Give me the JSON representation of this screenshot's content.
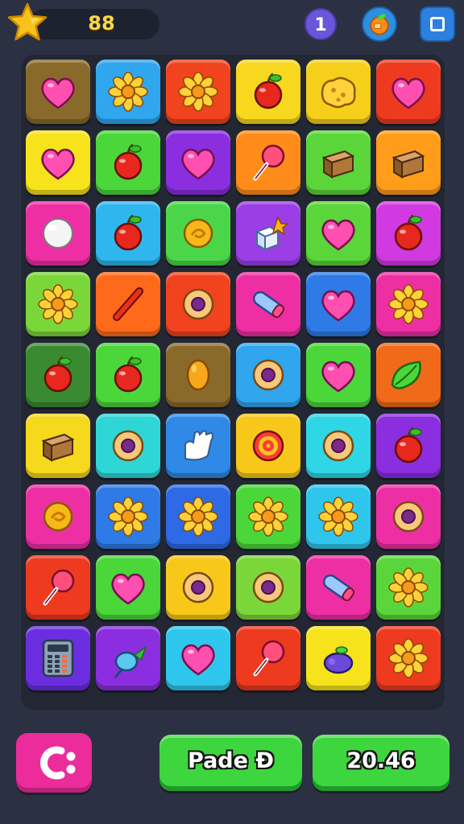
{
  "header": {
    "score": "88",
    "level": "1",
    "star_icon": "star-icon",
    "booster_icon": "fruit-booster-icon",
    "menu_icon": "square-menu-icon"
  },
  "board": {
    "rows": [
      [
        {
          "color": "#8a6a2a",
          "icon": "heart"
        },
        {
          "color": "#2fa6ee",
          "icon": "flower"
        },
        {
          "color": "#f0431e",
          "icon": "flower"
        },
        {
          "color": "#f7d81e",
          "icon": "apple"
        },
        {
          "color": "#f5cf1a",
          "icon": "cookie"
        },
        {
          "color": "#ee3a1f",
          "icon": "heart"
        }
      ],
      [
        {
          "color": "#f6e31c",
          "icon": "heart"
        },
        {
          "color": "#4bd63a",
          "icon": "apple"
        },
        {
          "color": "#8a2ee0",
          "icon": "heart"
        },
        {
          "color": "#ff8c1a",
          "icon": "lollipop"
        },
        {
          "color": "#5bd63a",
          "icon": "box"
        },
        {
          "color": "#ff9c1a",
          "icon": "box"
        }
      ],
      [
        {
          "color": "#ee2fa4",
          "icon": "ball"
        },
        {
          "color": "#2fb6ee",
          "icon": "apple"
        },
        {
          "color": "#4bd64a",
          "icon": "candy"
        },
        {
          "color": "#9b3ee6",
          "icon": "cube"
        },
        {
          "color": "#5bd63a",
          "icon": "heart"
        },
        {
          "color": "#d03ae0",
          "icon": "apple"
        }
      ],
      [
        {
          "color": "#7bd63a",
          "icon": "flower"
        },
        {
          "color": "#ff6a1a",
          "icon": "stick"
        },
        {
          "color": "#f0431e",
          "icon": "donut"
        },
        {
          "color": "#ee2fa4",
          "icon": "tube"
        },
        {
          "color": "#2e7ae6",
          "icon": "heart"
        },
        {
          "color": "#ee2fa4",
          "icon": "flower"
        }
      ],
      [
        {
          "color": "#3a8a32",
          "icon": "apple"
        },
        {
          "color": "#4bd63a",
          "icon": "apple"
        },
        {
          "color": "#8a6a2a",
          "icon": "lemon"
        },
        {
          "color": "#2fa6ee",
          "icon": "donut"
        },
        {
          "color": "#4bd63a",
          "icon": "heart"
        },
        {
          "color": "#f06a1a",
          "icon": "leaf"
        }
      ],
      [
        {
          "color": "#f6d81c",
          "icon": "box"
        },
        {
          "color": "#2fd6d6",
          "icon": "donut"
        },
        {
          "color": "#2e8ae6",
          "icon": "glove"
        },
        {
          "color": "#f7c81a",
          "icon": "target"
        },
        {
          "color": "#2fd6e6",
          "icon": "donut"
        },
        {
          "color": "#8a2ee0",
          "icon": "apple"
        }
      ],
      [
        {
          "color": "#ee2fa4",
          "icon": "candy"
        },
        {
          "color": "#2e7ae6",
          "icon": "flower"
        },
        {
          "color": "#2e6ae6",
          "icon": "flower"
        },
        {
          "color": "#4bd63a",
          "icon": "flower"
        },
        {
          "color": "#2fc6ee",
          "icon": "flower"
        },
        {
          "color": "#ee2fa4",
          "icon": "donut"
        }
      ],
      [
        {
          "color": "#ee3a1f",
          "icon": "lollipop"
        },
        {
          "color": "#4bd63a",
          "icon": "heart"
        },
        {
          "color": "#f7c81a",
          "icon": "donut"
        },
        {
          "color": "#7bd63a",
          "icon": "donut"
        },
        {
          "color": "#ee2fa4",
          "icon": "tube"
        },
        {
          "color": "#5bd63a",
          "icon": "flower"
        }
      ],
      [
        {
          "color": "#6a2ee0",
          "icon": "calculator"
        },
        {
          "color": "#8a2ee0",
          "icon": "bird"
        },
        {
          "color": "#2fc6ee",
          "icon": "heart"
        },
        {
          "color": "#ee3a1f",
          "icon": "lollipop"
        },
        {
          "color": "#f6e31c",
          "icon": "grape"
        },
        {
          "color": "#ee3a1f",
          "icon": "flower"
        }
      ]
    ]
  },
  "footer": {
    "undo_icon": "undo-icon",
    "left_label": "Pade Ð",
    "right_label": "20.46"
  }
}
